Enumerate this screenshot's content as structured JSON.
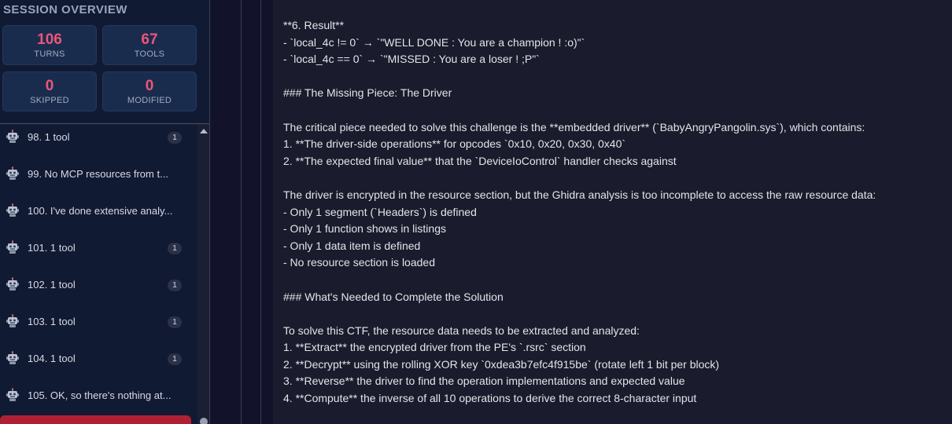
{
  "sidebar": {
    "title": "SESSION OVERVIEW",
    "stats": [
      {
        "value": "106",
        "label": "TURNS"
      },
      {
        "value": "67",
        "label": "TOOLS"
      },
      {
        "value": "0",
        "label": "SKIPPED"
      },
      {
        "value": "0",
        "label": "MODIFIED"
      }
    ],
    "turns": [
      {
        "label": "98. 1 tool",
        "badge": "1"
      },
      {
        "label": "99. No MCP resources from t..."
      },
      {
        "label": "100. I've done extensive analy..."
      },
      {
        "label": "101. 1 tool",
        "badge": "1"
      },
      {
        "label": "102. 1 tool",
        "badge": "1"
      },
      {
        "label": "103. 1 tool",
        "badge": "1"
      },
      {
        "label": "104. 1 tool",
        "badge": "1"
      },
      {
        "label": "105. OK, so there's nothing at..."
      }
    ]
  },
  "message": {
    "lines": [
      "**6. Result**",
      "- `local_4c != 0` → `\"WELL DONE : You are a champion ! :o)\"`",
      "- `local_4c == 0` → `\"MISSED : You are a loser ! ;P\"`",
      "",
      "### The Missing Piece: The Driver",
      "",
      "The critical piece needed to solve this challenge is the **embedded driver** (`BabyAngryPangolin.sys`), which contains:",
      "1. **The driver-side operations** for opcodes `0x10, 0x20, 0x30, 0x40`",
      "2. **The expected final value** that the `DeviceIoControl` handler checks against",
      "",
      "The driver is encrypted in the resource section, but the Ghidra analysis is too incomplete to access the raw resource data:",
      "- Only 1 segment (`Headers`) is defined",
      "- Only 1 function shows in listings",
      "- Only 1 data item is defined",
      "- No resource section is loaded",
      "",
      "### What's Needed to Complete the Solution",
      "",
      "To solve this CTF, the resource data needs to be extracted and analyzed:",
      "1. **Extract** the encrypted driver from the PE's `.rsrc` section",
      "2. **Decrypt** using the rolling XOR key `0xdea3b7efc4f915be` (rotate left 1 bit per block)",
      "3. **Reverse** the driver to find the operation implementations and expected value",
      "4. **Compute** the inverse of all 10 operations to derive the correct 8-character input"
    ]
  }
}
